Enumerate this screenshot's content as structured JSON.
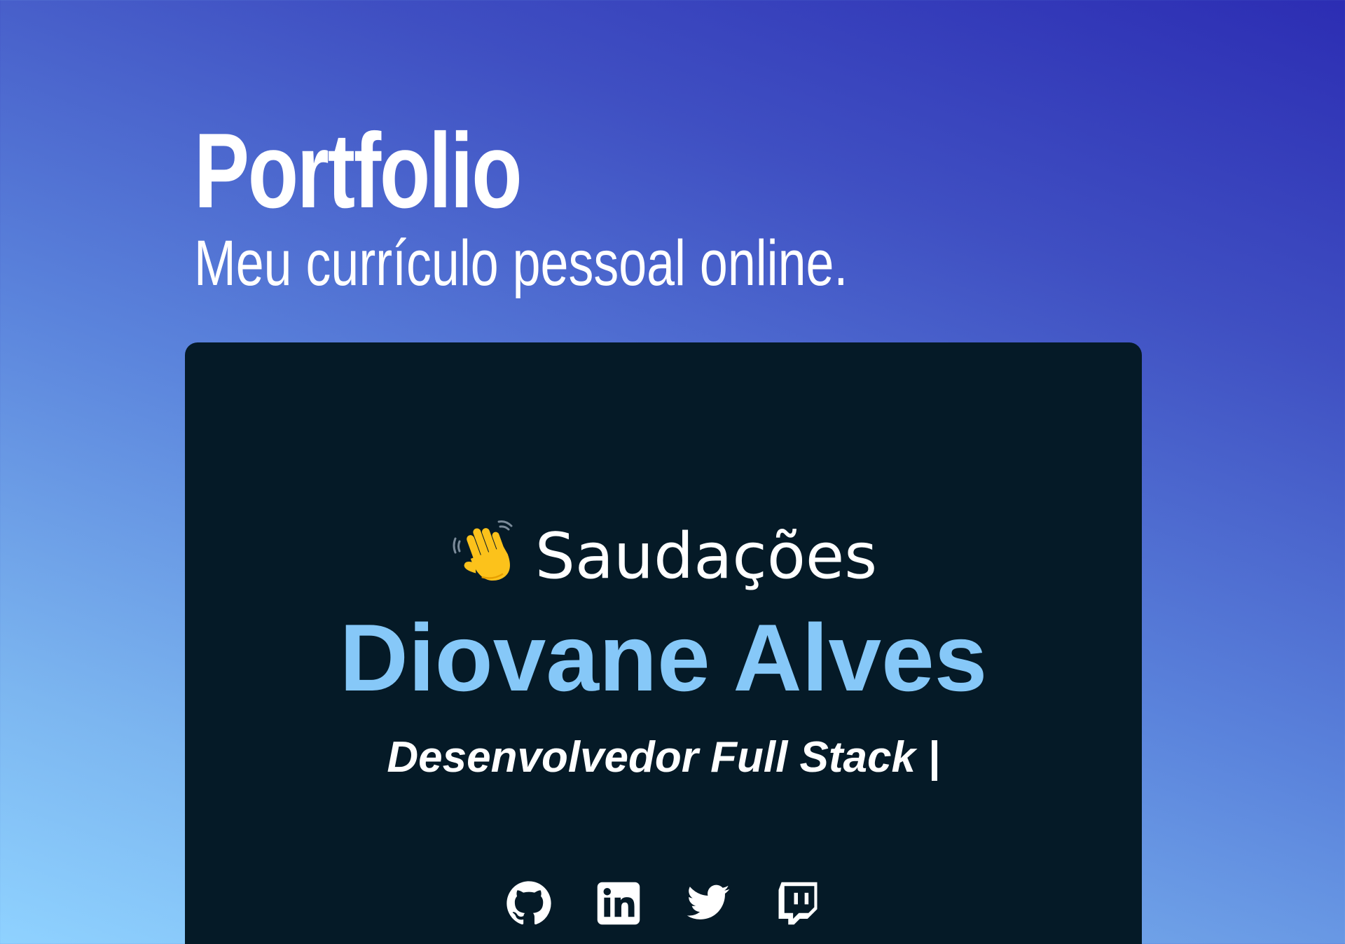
{
  "header": {
    "title": "Portfolio",
    "subtitle": "Meu currículo pessoal online."
  },
  "card": {
    "greeting": "Saudações",
    "greeting_icon": "waving-hand-icon",
    "name": "Diovane Alves",
    "role": "Desenvolvedor Full Stack |"
  },
  "social": [
    {
      "icon": "github-icon",
      "title": "GitHub"
    },
    {
      "icon": "linkedin-icon",
      "title": "LinkedIn"
    },
    {
      "icon": "twitter-icon",
      "title": "Twitter"
    },
    {
      "icon": "twitch-icon",
      "title": "Twitch"
    }
  ],
  "colors": {
    "card_background": "#051a27",
    "name_color": "#86c8f8",
    "gradient_start": "#8fd2ff",
    "gradient_end": "#2c2db3"
  }
}
